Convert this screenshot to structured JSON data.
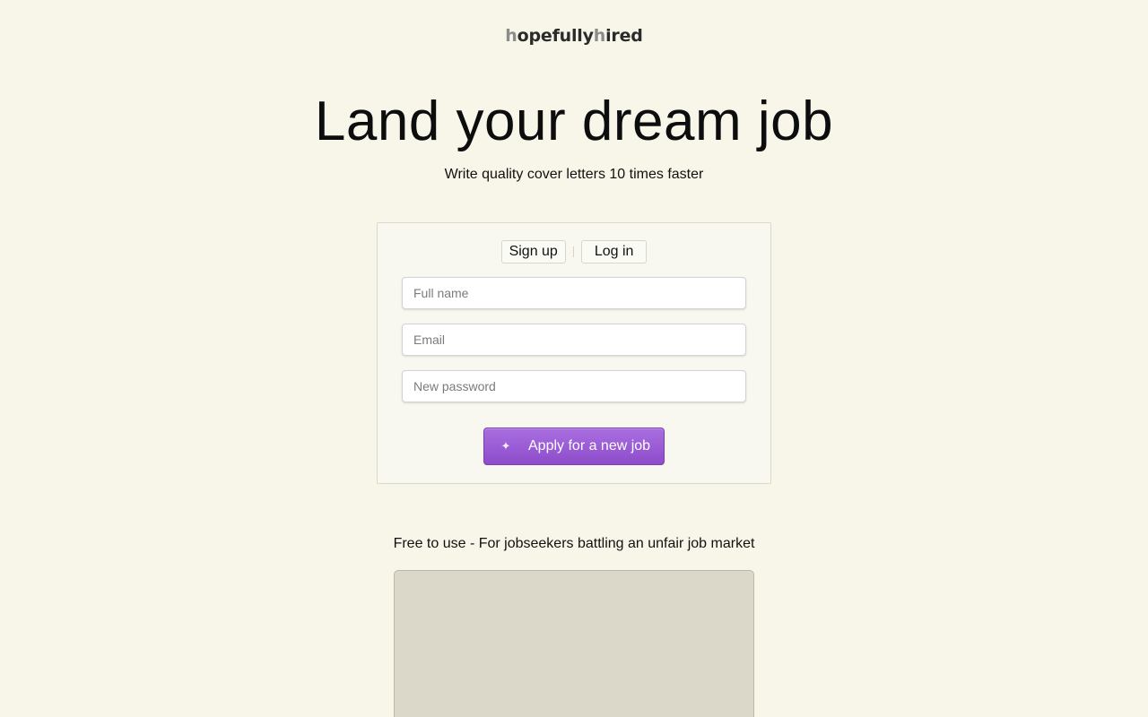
{
  "brand": {
    "logo_part1": "h",
    "logo_part2": "opefully",
    "logo_part3": "h",
    "logo_part4": "ired"
  },
  "hero": {
    "title": "Land your dream job",
    "subtitle": "Write quality cover letters 10 times faster"
  },
  "auth": {
    "tabs": [
      {
        "label": "Sign up"
      },
      {
        "label": "Log in"
      }
    ],
    "fields": {
      "full_name": {
        "value": "",
        "placeholder": "Full name"
      },
      "email": {
        "value": "",
        "placeholder": "Email"
      },
      "password": {
        "value": "",
        "placeholder": "New password"
      }
    },
    "submit": {
      "label": "Apply for a new job",
      "icon": "sparkle-icon"
    }
  },
  "footer": {
    "tagline": "Free to use - For jobseekers battling an unfair job market"
  },
  "colors": {
    "background": "#f8f6e9",
    "accent": "#9b5cd6",
    "card": "#f9f8f0",
    "preview": "#dbd8c9"
  }
}
